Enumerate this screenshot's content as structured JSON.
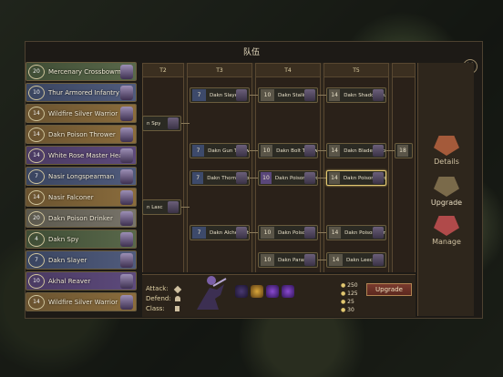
{
  "title": "队伍",
  "top_strip": [
    "",
    "",
    "",
    ""
  ],
  "units": [
    {
      "level": "20",
      "name": "Mercenary Crossbowman",
      "color": "green"
    },
    {
      "level": "10",
      "name": "Thur Armored Infantry",
      "color": "blue"
    },
    {
      "level": "14",
      "name": "Wildfire Silver Warrior",
      "color": "brown"
    },
    {
      "level": "14",
      "name": "Dakn Poison Thrower",
      "color": "brown"
    },
    {
      "level": "14",
      "name": "White Rose Master Healer",
      "color": "purple"
    },
    {
      "level": "7",
      "name": "Nasir Longspearman",
      "color": "blue"
    },
    {
      "level": "14",
      "name": "Nasir Falconer",
      "color": "brown"
    },
    {
      "level": "20",
      "name": "Dakn Poison Drinker",
      "color": "grey"
    },
    {
      "level": "4",
      "name": "Dakn Spy",
      "color": "green"
    },
    {
      "level": "7",
      "name": "Dakn Slayer",
      "color": "blue"
    },
    {
      "level": "10",
      "name": "Akhal Reaver",
      "color": "purple"
    },
    {
      "level": "14",
      "name": "Wildfire Silver Warrior",
      "color": "brown"
    }
  ],
  "tiers": [
    "T2",
    "T3",
    "T4",
    "T5"
  ],
  "tree_nodes": [
    {
      "level": "",
      "name": "n Spy",
      "color": "green",
      "id": "t2-spy"
    },
    {
      "level": "",
      "name": "n Lasc",
      "color": "green",
      "id": "t2-lasc"
    },
    {
      "level": "7",
      "name": "Dakn Slayer",
      "color": "blue",
      "id": "t3-slayer"
    },
    {
      "level": "7",
      "name": "Dakn Gun Thrower",
      "color": "blue",
      "id": "t3-gun"
    },
    {
      "level": "7",
      "name": "Dakn Thorn Thrower",
      "color": "blue",
      "id": "t3-thorn"
    },
    {
      "level": "7",
      "name": "Dakn Alchemist",
      "color": "blue",
      "id": "t3-alch"
    },
    {
      "level": "10",
      "name": "Dakn Stalker",
      "color": "grey",
      "id": "t4-stalker"
    },
    {
      "level": "10",
      "name": "Dakn Bolt Thrower",
      "color": "grey",
      "id": "t4-bolt"
    },
    {
      "level": "10",
      "name": "Dakn Poison Thrower",
      "color": "purple",
      "id": "t4-poison"
    },
    {
      "level": "10",
      "name": "Dakn Poisoner",
      "color": "grey",
      "id": "t4-poisoner"
    },
    {
      "level": "10",
      "name": "Dakn Parasite",
      "color": "grey",
      "id": "t4-parasite"
    },
    {
      "level": "14",
      "name": "Dakn Shadow Guard",
      "color": "grey",
      "id": "t5-shadow"
    },
    {
      "level": "14",
      "name": "Dakn Blade Thrower",
      "color": "grey",
      "id": "t5-blade"
    },
    {
      "level": "14",
      "name": "Dakn Poison Thrower",
      "color": "grey",
      "id": "t5-poison"
    },
    {
      "level": "14",
      "name": "Dakn Poison Spray",
      "color": "grey",
      "id": "t5-spray"
    },
    {
      "level": "14",
      "name": "Dakn Leech",
      "color": "grey",
      "id": "t5-leech"
    },
    {
      "level": "18",
      "name": "",
      "color": "grey",
      "id": "t6-18"
    }
  ],
  "info": {
    "attack_label": "Attack:",
    "defend_label": "Defend:",
    "class_label": "Class:",
    "resources": [
      "250",
      "125",
      "25",
      "30"
    ],
    "upgrade_label": "Upgrade"
  },
  "menu": [
    {
      "label": "Details",
      "icon": "helmet-icon",
      "active": false
    },
    {
      "label": "Upgrade",
      "icon": "upgrade-icon",
      "active": true
    },
    {
      "label": "Manage",
      "icon": "banner-icon",
      "active": false
    }
  ],
  "bottom_strip": [
    "",
    "",
    "",
    "",
    ""
  ],
  "colors": {
    "green": "#3f4d35",
    "blue": "#3a4560",
    "brown": "#6a5330",
    "purple": "#4a3a62",
    "grey": "#5b584d",
    "gold": "#e2c770"
  }
}
